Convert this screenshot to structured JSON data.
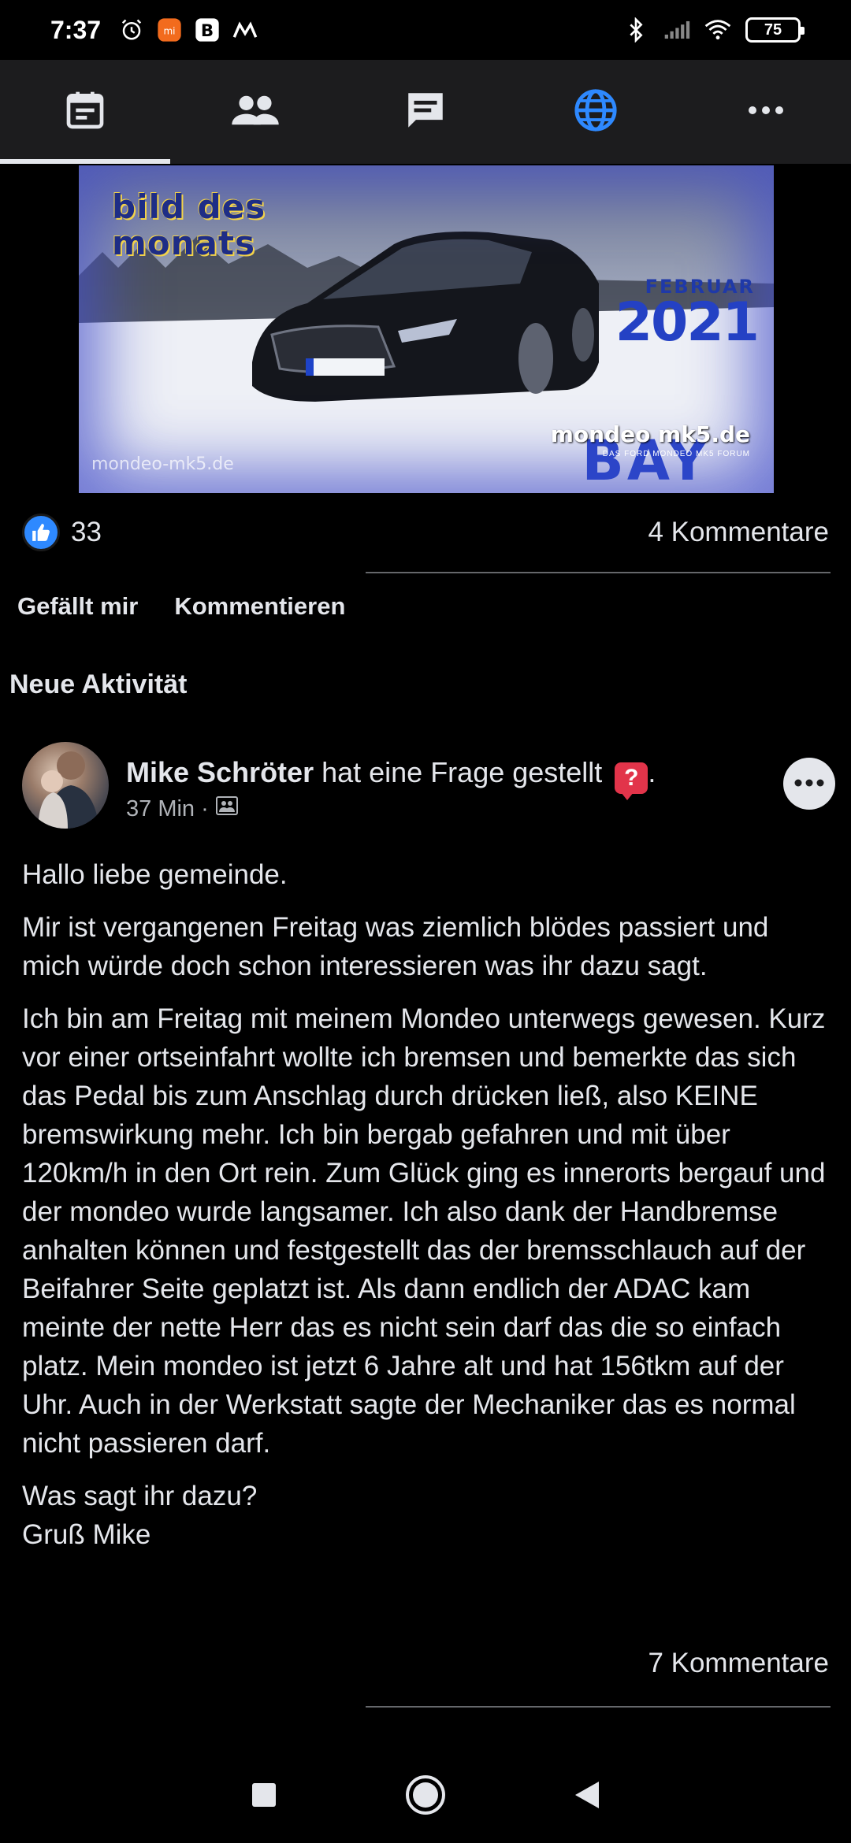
{
  "status_bar": {
    "time": "7:37",
    "battery": "75",
    "left_icons": [
      "alarm-icon",
      "mi-app-icon",
      "b-app-icon",
      "m-app-icon"
    ],
    "right_icons": [
      "bluetooth-icon",
      "signal-icon",
      "wifi-icon",
      "battery-icon"
    ]
  },
  "tabs": [
    {
      "icon": "calendar-icon",
      "active": true
    },
    {
      "icon": "members-icon",
      "active": false
    },
    {
      "icon": "messages-icon",
      "active": false
    },
    {
      "icon": "globe-icon",
      "active": false
    },
    {
      "icon": "more-icon",
      "active": false
    }
  ],
  "banner": {
    "title": "bild des monats",
    "month": "FEBRUAR",
    "year": "2021",
    "site": "mondeo mk5.de",
    "site_sub": "DAS FORD MONDEO MK5 FORUM",
    "watermark": "mondeo-mk5.de",
    "bay": "BAY"
  },
  "pinned_post": {
    "like_count": "33",
    "comments": "4 Kommentare",
    "like_action": "Gefällt mir",
    "comment_action": "Kommentieren"
  },
  "section": {
    "heading": "Neue Aktivität"
  },
  "post": {
    "author": "Mike Schröter",
    "action": " hat eine Frage gestellt ",
    "action_suffix": ".",
    "time": "37 Min ·",
    "paragraphs": [
      "Hallo liebe gemeinde.",
      "Mir ist vergangenen Freitag was ziemlich blödes passiert und mich würde doch schon interessieren was ihr dazu sagt.",
      "Ich bin am Freitag mit meinem Mondeo unterwegs gewesen. Kurz vor einer ortseinfahrt wollte ich bremsen und bemerkte das sich das Pedal bis zum Anschlag durch drücken ließ, also KEINE bremswirkung mehr. Ich bin bergab gefahren und mit über 120km/h in den Ort rein. Zum Glück ging es innerorts bergauf und der mondeo wurde langsamer. Ich also dank der Handbremse anhalten können und festgestellt das der bremsschlauch auf der Beifahrer Seite geplatzt ist. Als dann endlich der ADAC kam meinte der nette Herr das es nicht sein darf das die so einfach platz. Mein mondeo ist jetzt 6 Jahre alt und hat 156tkm auf der Uhr. Auch in der Werkstatt sagte der Mechaniker das es normal nicht passieren darf.",
      "Was sagt ihr dazu?",
      "Gruß Mike"
    ],
    "comments": "7 Kommentare"
  },
  "colors": {
    "background": "#000000",
    "tab_bar": "#1c1c1e",
    "accent": "#2e89ff",
    "text": "#e4e6eb",
    "muted": "#b0b3b8",
    "question": "#e2344a"
  }
}
